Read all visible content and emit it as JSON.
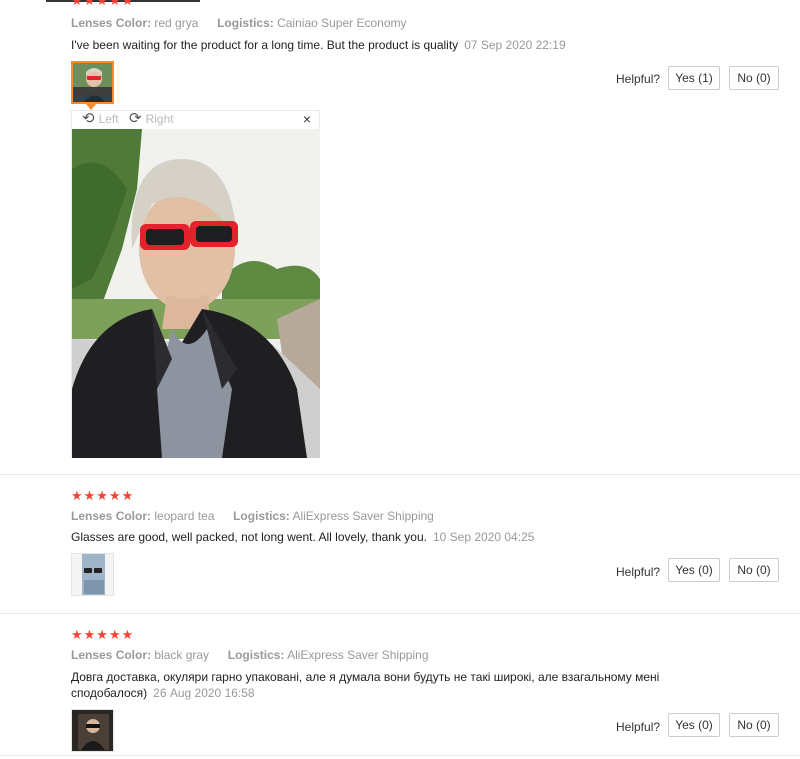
{
  "labels": {
    "lenses_color": "Lenses Color:",
    "logistics": "Logistics:",
    "helpful": "Helpful?"
  },
  "viewer": {
    "left_label": "Left",
    "right_label": "Right",
    "close_glyph": "×",
    "rotate_left_glyph": "⟲",
    "rotate_right_glyph": "⟳"
  },
  "reviews": [
    {
      "stars": "★★★★★",
      "lenses_color": "red grya",
      "logistics": "Cainiao Super Economy",
      "text": "I've been waiting for the product for a long time. But the product is quality",
      "date": "07 Sep 2020 22:19",
      "yes": "Yes (1)",
      "no": "No (0)"
    },
    {
      "stars": "★★★★★",
      "lenses_color": "leopard tea",
      "logistics": "AliExpress Saver Shipping",
      "text": "Glasses are good, well packed, not long went. All lovely, thank you.",
      "date": "10 Sep 2020 04:25",
      "yes": "Yes (0)",
      "no": "No (0)"
    },
    {
      "stars": "★★★★★",
      "lenses_color": "black gray",
      "logistics": "AliExpress Saver Shipping",
      "text": "Довга доставка, окуляри гарно упаковані, але я думала вони будуть не такі широкі, але взагальному мені сподобалося)",
      "date": "26 Aug 2020 16:58",
      "yes": "Yes (0)",
      "no": "No (0)"
    }
  ]
}
